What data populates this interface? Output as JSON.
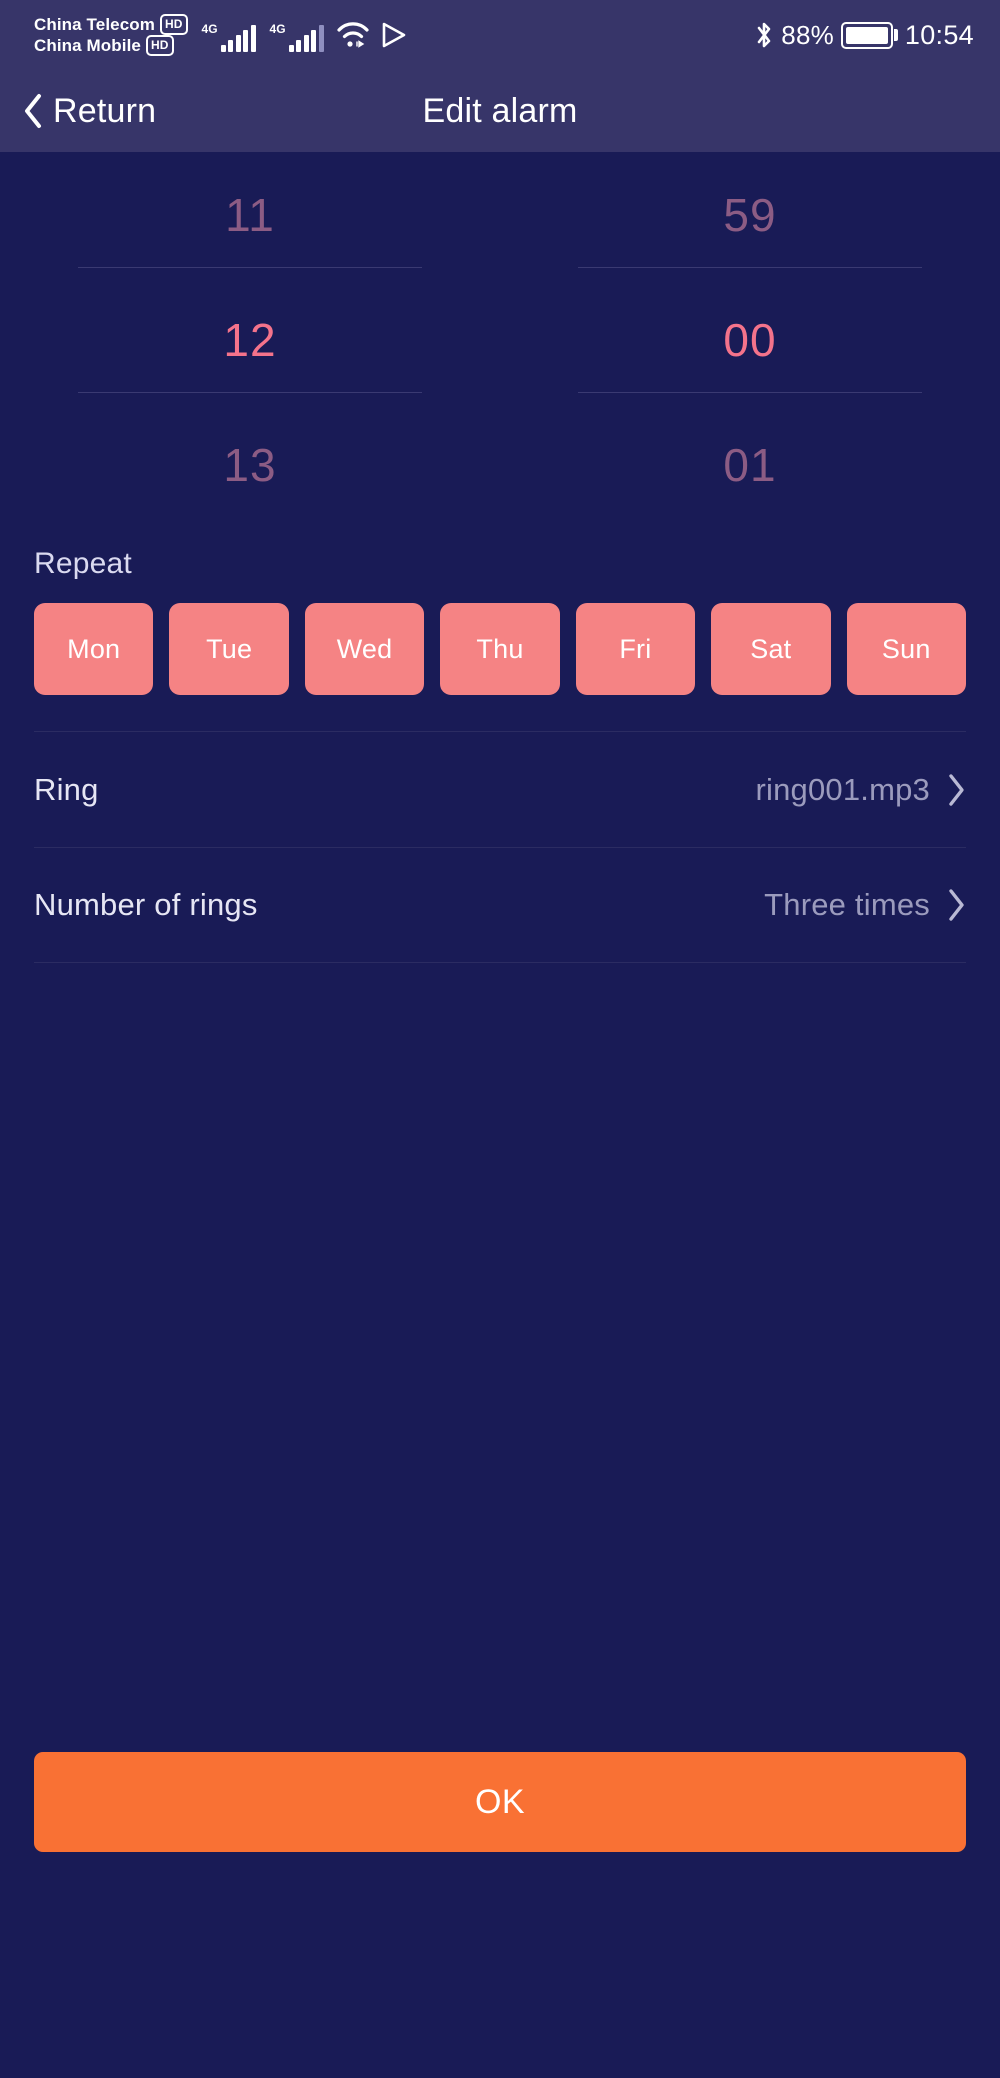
{
  "status_bar": {
    "carriers": [
      {
        "name": "China Telecom",
        "badge": "HD"
      },
      {
        "name": "China Mobile",
        "badge": "HD"
      }
    ],
    "signals": [
      {
        "generation": "4G"
      },
      {
        "generation": "4G"
      }
    ],
    "wifi_icon": "wifi-icon",
    "cast_icon": "play-cast-icon",
    "bluetooth_icon": "bluetooth-icon",
    "battery_percent": "88%",
    "battery_icon": "battery-icon",
    "time": "10:54"
  },
  "header": {
    "back_icon": "chevron-left-icon",
    "back_label": "Return",
    "title": "Edit alarm"
  },
  "time_picker": {
    "hours": {
      "previous": "11",
      "selected": "12",
      "next": "13"
    },
    "minutes": {
      "previous": "59",
      "selected": "00",
      "next": "01"
    },
    "selected_color": "#f4738b",
    "dim_color": "#8c5c84"
  },
  "repeat": {
    "label": "Repeat",
    "accent_color": "#f58384",
    "days": [
      {
        "label": "Mon",
        "selected": true
      },
      {
        "label": "Tue",
        "selected": true
      },
      {
        "label": "Wed",
        "selected": true
      },
      {
        "label": "Thu",
        "selected": true
      },
      {
        "label": "Fri",
        "selected": true
      },
      {
        "label": "Sat",
        "selected": true
      },
      {
        "label": "Sun",
        "selected": true
      }
    ]
  },
  "settings_rows": [
    {
      "label": "Ring",
      "value": "ring001.mp3",
      "chevron": "chevron-right-icon"
    },
    {
      "label": "Number of rings",
      "value": "Three times",
      "chevron": "chevron-right-icon"
    }
  ],
  "footer": {
    "ok_label": "OK",
    "ok_color": "#f97134"
  }
}
